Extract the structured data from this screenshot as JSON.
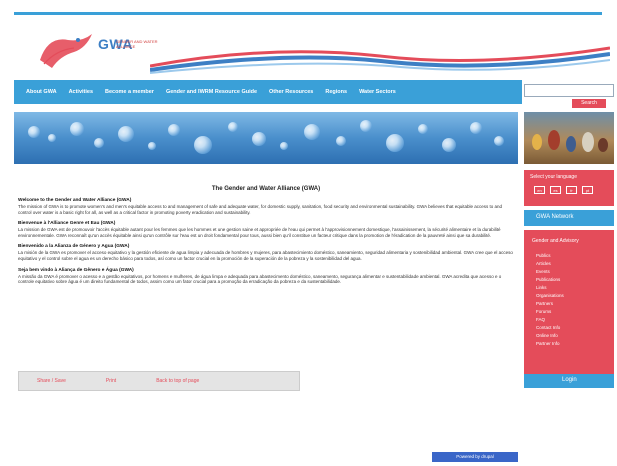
{
  "logo": {
    "name": "GWA",
    "subtitle": "GENDER AND WATER ALLIANCE"
  },
  "nav": {
    "items": [
      "About GWA",
      "Activities",
      "Become a member",
      "Gender and IWRM Resource Guide",
      "Other Resources",
      "Regions",
      "Water Sectors"
    ]
  },
  "search": {
    "placeholder": "",
    "button_label": "Search"
  },
  "language": {
    "title": "Select your language",
    "flags": [
      "en",
      "es",
      "fr",
      "pt"
    ]
  },
  "sidebar": {
    "header": "GWA Network",
    "nav_title": "Gender and Advisory",
    "items": [
      "Publics",
      "Articles",
      "Events",
      "Publications",
      "Links",
      "Organisations",
      "Partners",
      "Forums",
      "FAQ",
      "Contact Info",
      "Online Info",
      "Partner Info"
    ],
    "footer": "Login"
  },
  "main": {
    "title": "The Gender and Water Alliance (GWA)",
    "paragraphs": [
      {
        "heading": "Welcome to the Gender and Water Alliance (GWA)",
        "body": "The mission of GWA is to promote women's and men's equitable access to and management of safe and adequate water, for domestic supply, sanitation, food security and environmental sustainability. GWA believes that equitable access to and control over water is a basic right for all, as well as a critical factor in promoting poverty eradication and sustainability."
      },
      {
        "heading": "Bienvenue à l'Alliance Genre et Eau (GWA)",
        "body": "La mission de GWA est de promouvoir l'accès équitable autant pour les femmes que les hommes et une gestion saine et appropriée de l'eau qui permet à l'approvisionnement domestique, l'assainissement, la sécurité alimentaire et la durabilité environnementale. GWA reconnaît qu'un accès équitable ainsi qu'un contrôle sur l'eau est un droit fondamental pour tous, aussi bien qu'il constitue un facteur critique dans la promotion de l'éradication de la pauvreté ainsi que sa durabilité."
      },
      {
        "heading": "Bienvenido a la Alianza de Género y Agua (GWA)",
        "body": "La misión de la GWA es promover el acceso equitativo y la gestión eficiente de agua limpia y adecuada de hombres y mujeres, para abastecimiento doméstico, saneamiento, seguridad alimentaria y sostenibilidad ambiental. GWA cree que el acceso equitativo y el control sobre el agua es un derecho básico para todos, así como un factor crucial en la promoción de la superación de la pobreza y la sostenibilidad del agua."
      },
      {
        "heading": "Seja bem vindo à Aliança de Gênero e Água (GWA)",
        "body": "A missão da GWA é promover o acesso e a gestão equitativos, por homens e mulheres, de água limpa e adequada para abastecimento doméstico, saneamento, segurança alimentar e sustentabilidade ambiental. GWA acredita que acesso e o controle equitativo sobre água é um direito fundamental de todos, assim como um fator crucial para a promoção da erradicação da pobreza e da sustentabilidade."
      }
    ]
  },
  "footer": {
    "links": [
      "Share / Save",
      "Print",
      "Back to top of page"
    ]
  },
  "bottom_button": "Powered by drupal",
  "colors": {
    "accent_blue": "#3aa0d8",
    "accent_red": "#e44c5a",
    "button_blue": "#3a66c8"
  }
}
